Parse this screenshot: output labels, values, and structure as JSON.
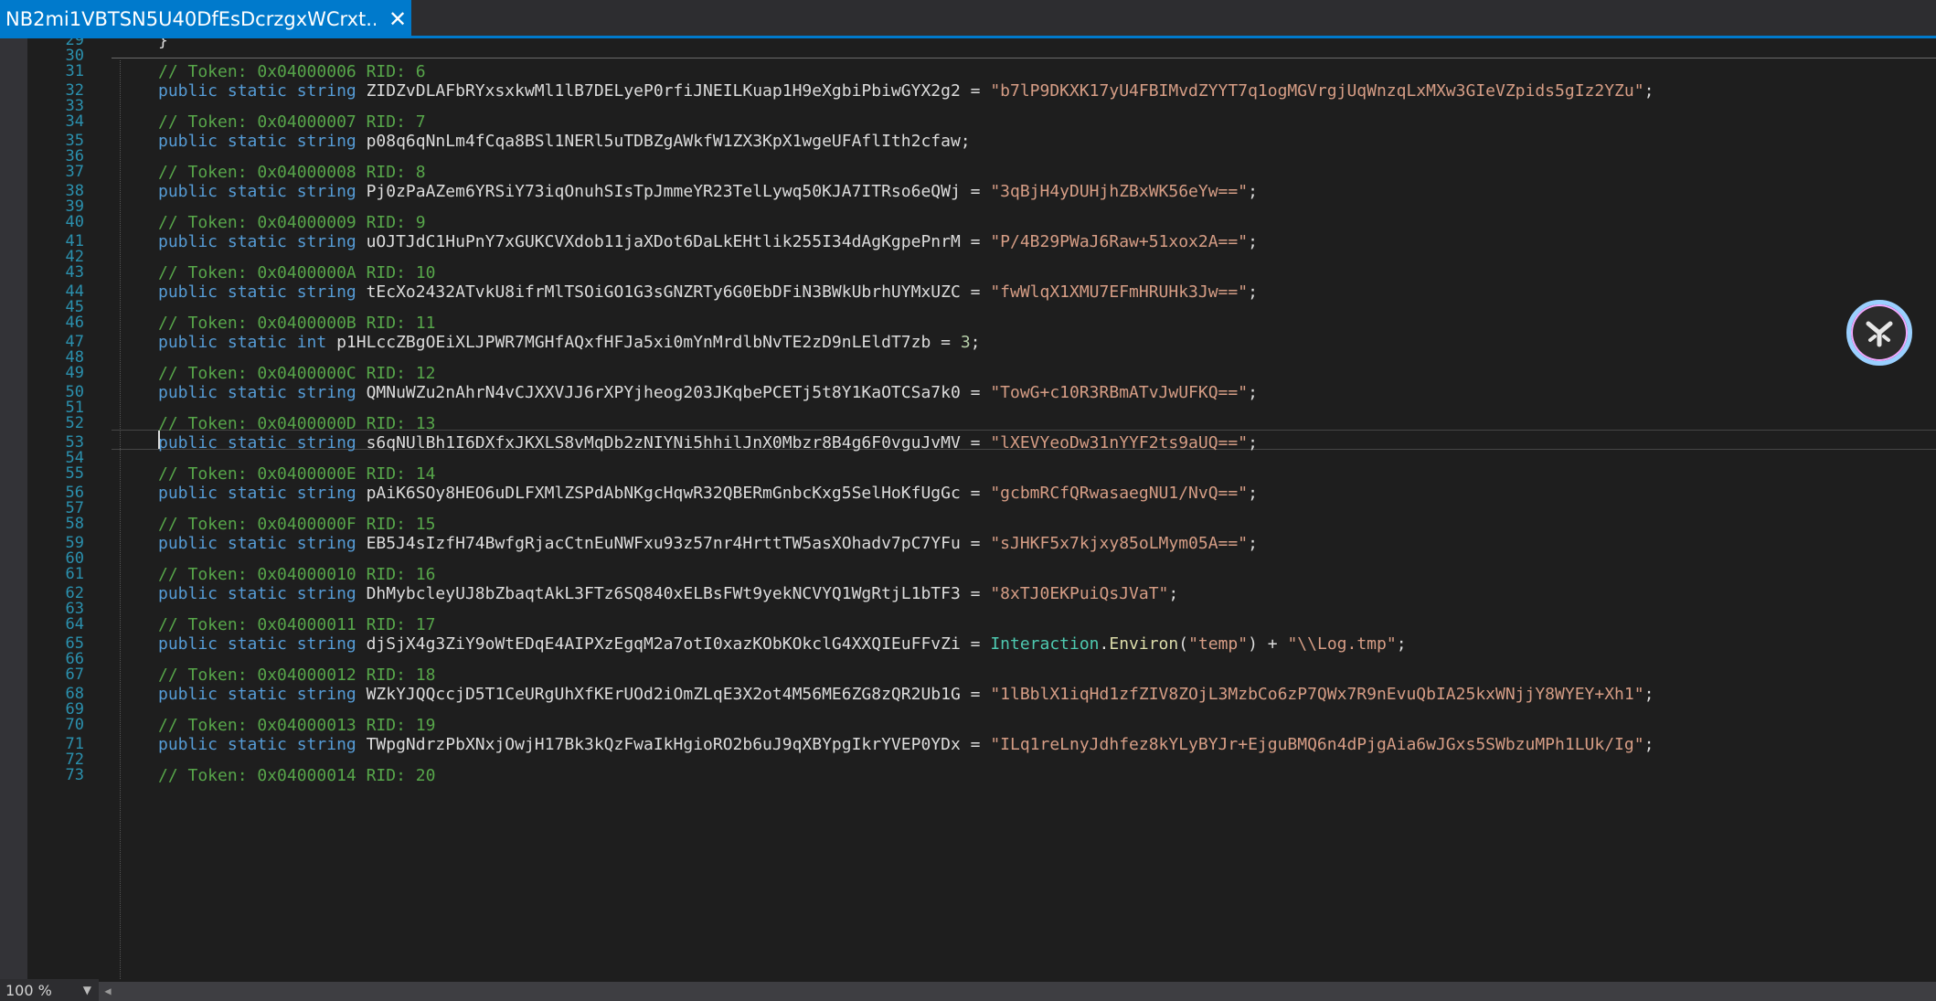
{
  "tab": {
    "title": "NB2mi1VBTSN5U40DfEsDcrzgxWCrxt...",
    "close": "✕"
  },
  "status": {
    "zoom": "100 %"
  },
  "code_rows": [
    {
      "ln": "29",
      "tokens": [
        {
          "t": "}",
          "c": "pl"
        }
      ]
    },
    {
      "ln": "30",
      "tokens": []
    },
    {
      "ln": "31",
      "tokens": [
        {
          "t": "// Token: 0x04000006 RID: 6",
          "c": "cm"
        }
      ]
    },
    {
      "ln": "32",
      "tokens": [
        {
          "t": "public static string ",
          "c": "kw"
        },
        {
          "t": "ZIDZvDLAFbRYxsxkwMl1lB7DELyeP0rfiJNEILKuap1H9eXgbiPbiwGYX2g2 = ",
          "c": "pl"
        },
        {
          "t": "\"b7lP9DKXK17yU4FBIMvdZYYT7q1ogMGVrgjUqWnzqLxMXw3GIeVZpids5gIz2YZu\"",
          "c": "str"
        },
        {
          "t": ";",
          "c": "pl"
        }
      ]
    },
    {
      "ln": "33",
      "tokens": []
    },
    {
      "ln": "34",
      "tokens": [
        {
          "t": "// Token: 0x04000007 RID: 7",
          "c": "cm"
        }
      ]
    },
    {
      "ln": "35",
      "tokens": [
        {
          "t": "public static string ",
          "c": "kw"
        },
        {
          "t": "p08q6qNnLm4fCqa8BSl1NERl5uTDBZgAWkfW1ZX3KpX1wgeUFAflIth2cfaw;",
          "c": "pl"
        }
      ]
    },
    {
      "ln": "36",
      "tokens": []
    },
    {
      "ln": "37",
      "tokens": [
        {
          "t": "// Token: 0x04000008 RID: 8",
          "c": "cm"
        }
      ]
    },
    {
      "ln": "38",
      "tokens": [
        {
          "t": "public static string ",
          "c": "kw"
        },
        {
          "t": "Pj0zPaAZem6YRSiY73iqOnuhSIsTpJmmeYR23TelLywq50KJA7ITRso6eQWj = ",
          "c": "pl"
        },
        {
          "t": "\"3qBjH4yDUHjhZBxWK56eYw==\"",
          "c": "str"
        },
        {
          "t": ";",
          "c": "pl"
        }
      ]
    },
    {
      "ln": "39",
      "tokens": []
    },
    {
      "ln": "40",
      "tokens": [
        {
          "t": "// Token: 0x04000009 RID: 9",
          "c": "cm"
        }
      ]
    },
    {
      "ln": "41",
      "tokens": [
        {
          "t": "public static string ",
          "c": "kw"
        },
        {
          "t": "uOJTJdC1HuPnY7xGUKCVXdob11jaXDot6DaLkEHtlik255I34dAgKgpePnrM = ",
          "c": "pl"
        },
        {
          "t": "\"P/4B29PWaJ6Raw+51xox2A==\"",
          "c": "str"
        },
        {
          "t": ";",
          "c": "pl"
        }
      ]
    },
    {
      "ln": "42",
      "tokens": []
    },
    {
      "ln": "43",
      "tokens": [
        {
          "t": "// Token: 0x0400000A RID: 10",
          "c": "cm"
        }
      ]
    },
    {
      "ln": "44",
      "tokens": [
        {
          "t": "public static string ",
          "c": "kw"
        },
        {
          "t": "tEcXo2432ATvkU8ifrMlTSOiGO1G3sGNZRTy6G0EbDFiN3BWkUbrhUYMxUZC = ",
          "c": "pl"
        },
        {
          "t": "\"fwWlqX1XMU7EFmHRUHk3Jw==\"",
          "c": "str"
        },
        {
          "t": ";",
          "c": "pl"
        }
      ]
    },
    {
      "ln": "45",
      "tokens": []
    },
    {
      "ln": "46",
      "tokens": [
        {
          "t": "// Token: 0x0400000B RID: 11",
          "c": "cm"
        }
      ]
    },
    {
      "ln": "47",
      "tokens": [
        {
          "t": "public static int ",
          "c": "kw"
        },
        {
          "t": "p1HLccZBgOEiXLJPWR7MGHfAQxfHFJa5xi0mYnMrdlbNvTE2zD9nLEldT7zb = ",
          "c": "pl"
        },
        {
          "t": "3",
          "c": "num"
        },
        {
          "t": ";",
          "c": "pl"
        }
      ]
    },
    {
      "ln": "48",
      "tokens": []
    },
    {
      "ln": "49",
      "tokens": [
        {
          "t": "// Token: 0x0400000C RID: 12",
          "c": "cm"
        }
      ]
    },
    {
      "ln": "50",
      "tokens": [
        {
          "t": "public static string ",
          "c": "kw"
        },
        {
          "t": "QMNuWZu2nAhrN4vCJXXVJJ6rXPYjheog203JKqbePCETj5t8Y1KaOTCSa7k0 = ",
          "c": "pl"
        },
        {
          "t": "\"TowG+c10R3RBmATvJwUFKQ==\"",
          "c": "str"
        },
        {
          "t": ";",
          "c": "pl"
        }
      ]
    },
    {
      "ln": "51",
      "tokens": []
    },
    {
      "ln": "52",
      "tokens": [
        {
          "t": "// Token: 0x0400000D RID: 13",
          "c": "cm"
        }
      ]
    },
    {
      "ln": "53",
      "tokens": [
        {
          "t": "public static string ",
          "c": "kw"
        },
        {
          "t": "s6qNUlBh1I6DXfxJKXLS8vMqDb2zNIYNi5hhilJnX0Mbzr8B4g6F0vguJvMV = ",
          "c": "pl"
        },
        {
          "t": "\"lXEVYeoDw31nYYF2ts9aUQ==\"",
          "c": "str"
        },
        {
          "t": ";",
          "c": "pl"
        }
      ]
    },
    {
      "ln": "54",
      "tokens": []
    },
    {
      "ln": "55",
      "tokens": [
        {
          "t": "// Token: 0x0400000E RID: 14",
          "c": "cm"
        }
      ]
    },
    {
      "ln": "56",
      "tokens": [
        {
          "t": "public static string ",
          "c": "kw"
        },
        {
          "t": "pAiK6SOy8HEO6uDLFXMlZSPdAbNKgcHqwR32QBERmGnbcKxg5SelHoKfUgGc = ",
          "c": "pl"
        },
        {
          "t": "\"gcbmRCfQRwasaegNU1/NvQ==\"",
          "c": "str"
        },
        {
          "t": ";",
          "c": "pl"
        }
      ]
    },
    {
      "ln": "57",
      "tokens": []
    },
    {
      "ln": "58",
      "tokens": [
        {
          "t": "// Token: 0x0400000F RID: 15",
          "c": "cm"
        }
      ]
    },
    {
      "ln": "59",
      "tokens": [
        {
          "t": "public static string ",
          "c": "kw"
        },
        {
          "t": "EB5J4sIzfH74BwfgRjacCtnEuNWFxu93z57nr4HrttTW5asXOhadv7pC7YFu = ",
          "c": "pl"
        },
        {
          "t": "\"sJHKF5x7kjxy85oLMym05A==\"",
          "c": "str"
        },
        {
          "t": ";",
          "c": "pl"
        }
      ]
    },
    {
      "ln": "60",
      "tokens": []
    },
    {
      "ln": "61",
      "tokens": [
        {
          "t": "// Token: 0x04000010 RID: 16",
          "c": "cm"
        }
      ]
    },
    {
      "ln": "62",
      "tokens": [
        {
          "t": "public static string ",
          "c": "kw"
        },
        {
          "t": "DhMybcleyUJ8bZbaqtAkL3FTz6SQ840xELBsFWt9yekNCVYQ1WgRtjL1bTF3 = ",
          "c": "pl"
        },
        {
          "t": "\"8xTJ0EKPuiQsJVaT\"",
          "c": "str"
        },
        {
          "t": ";",
          "c": "pl"
        }
      ]
    },
    {
      "ln": "63",
      "tokens": []
    },
    {
      "ln": "64",
      "tokens": [
        {
          "t": "// Token: 0x04000011 RID: 17",
          "c": "cm"
        }
      ]
    },
    {
      "ln": "65",
      "tokens": [
        {
          "t": "public static string ",
          "c": "kw"
        },
        {
          "t": "djSjX4g3ZiY9oWtEDqE4AIPXzEgqM2a7otI0xazKObKOkclG4XXQIEuFFvZi = ",
          "c": "pl"
        },
        {
          "t": "Interaction",
          "c": "cls"
        },
        {
          "t": ".",
          "c": "pl"
        },
        {
          "t": "Environ",
          "c": "mth"
        },
        {
          "t": "(",
          "c": "pl"
        },
        {
          "t": "\"temp\"",
          "c": "str"
        },
        {
          "t": ") + ",
          "c": "pl"
        },
        {
          "t": "\"\\\\Log.tmp\"",
          "c": "str"
        },
        {
          "t": ";",
          "c": "pl"
        }
      ]
    },
    {
      "ln": "66",
      "tokens": []
    },
    {
      "ln": "67",
      "tokens": [
        {
          "t": "// Token: 0x04000012 RID: 18",
          "c": "cm"
        }
      ]
    },
    {
      "ln": "68",
      "tokens": [
        {
          "t": "public static string ",
          "c": "kw"
        },
        {
          "t": "WZkYJQQccjD5T1CeURgUhXfKErUOd2iOmZLqE3X2ot4M56ME6ZG8zQR2Ub1G = ",
          "c": "pl"
        },
        {
          "t": "\"1lBblX1iqHd1zfZIV8ZOjL3MzbCo6zP7QWx7R9nEvuQbIA25kxWNjjY8WYEY+Xh1\"",
          "c": "str"
        },
        {
          "t": ";",
          "c": "pl"
        }
      ]
    },
    {
      "ln": "69",
      "tokens": []
    },
    {
      "ln": "70",
      "tokens": [
        {
          "t": "// Token: 0x04000013 RID: 19",
          "c": "cm"
        }
      ]
    },
    {
      "ln": "71",
      "tokens": [
        {
          "t": "public static string ",
          "c": "kw"
        },
        {
          "t": "TWpgNdrzPbXNxjOwjH17Bk3kQzFwaIkHgioRO2b6uJ9qXBYpgIkrYVEP0YDx = ",
          "c": "pl"
        },
        {
          "t": "\"ILq1reLnyJdhfez8kYLyBYJr+EjguBMQ6n4dPjgAia6wJGxs5SWbzuMPh1LUk/Ig\"",
          "c": "str"
        },
        {
          "t": ";",
          "c": "pl"
        }
      ]
    },
    {
      "ln": "72",
      "tokens": []
    },
    {
      "ln": "73",
      "tokens": [
        {
          "t": "// Token: 0x04000014 RID: 20",
          "c": "cm"
        }
      ]
    }
  ],
  "colors": {
    "background": "#1e1e1e",
    "tab_active": "#007acc",
    "keyword": "#569cd6",
    "string": "#d69d85",
    "comment": "#57a64a",
    "line_number": "#2b91af",
    "type": "#4ec9b0",
    "method": "#dcdcaa"
  },
  "icons": {
    "assistant": "ai-assistant-icon",
    "close": "close-icon"
  }
}
